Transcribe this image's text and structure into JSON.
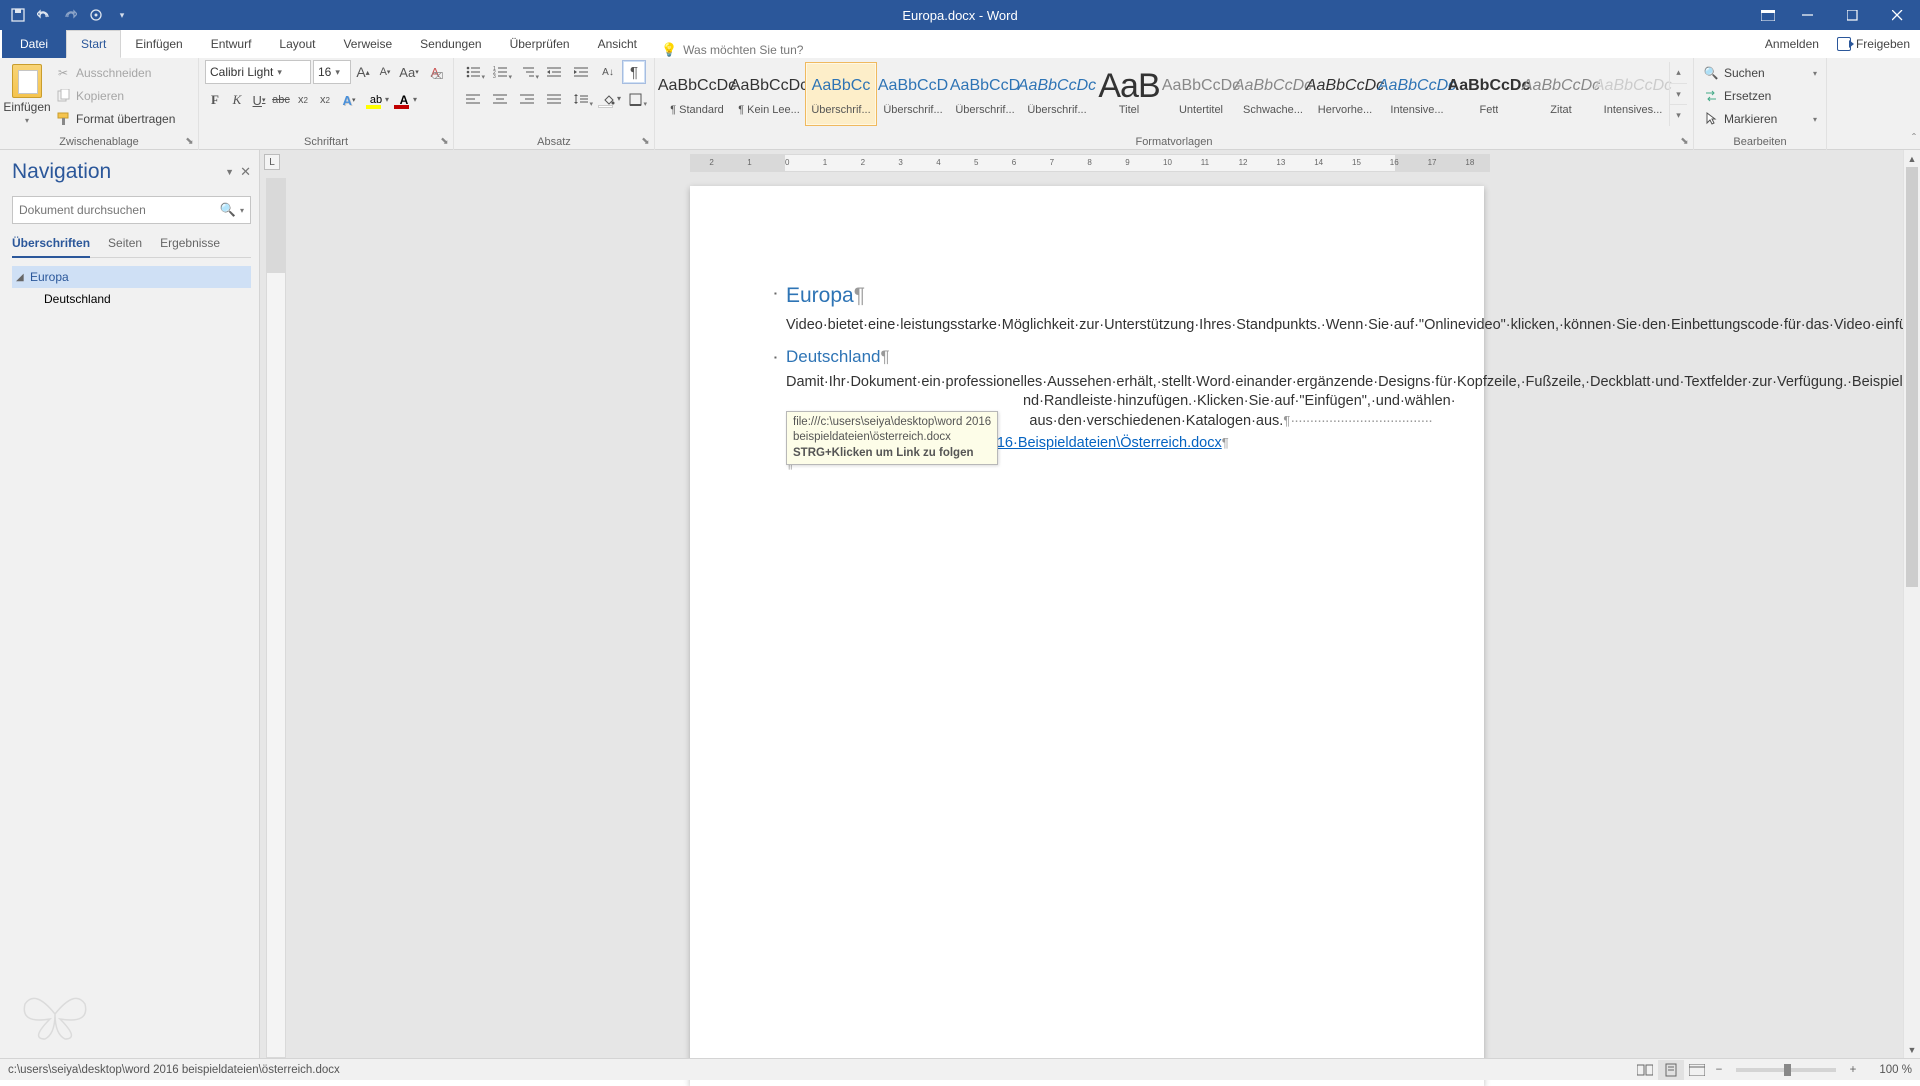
{
  "titlebar": {
    "title": "Europa.docx - Word"
  },
  "tabs": {
    "file": "Datei",
    "items": [
      "Start",
      "Einfügen",
      "Entwurf",
      "Layout",
      "Verweise",
      "Sendungen",
      "Überprüfen",
      "Ansicht"
    ],
    "active": "Start",
    "tellme": "Was möchten Sie tun?",
    "signin": "Anmelden",
    "share": "Freigeben"
  },
  "ribbon": {
    "clipboard": {
      "paste": "Einfügen",
      "cut": "Ausschneiden",
      "copy": "Kopieren",
      "format_painter": "Format übertragen",
      "label": "Zwischenablage"
    },
    "font": {
      "name": "Calibri Light",
      "size": "16",
      "label": "Schriftart"
    },
    "paragraph": {
      "label": "Absatz"
    },
    "styles": {
      "label": "Formatvorlagen",
      "items": [
        {
          "name": "¶ Standard",
          "preview": "AaBbCcDc",
          "cls": ""
        },
        {
          "name": "¶ Kein Lee...",
          "preview": "AaBbCcDc",
          "cls": ""
        },
        {
          "name": "Überschrif...",
          "preview": "AaBbCc",
          "cls": "blue",
          "sel": true
        },
        {
          "name": "Überschrif...",
          "preview": "AaBbCcD",
          "cls": "blue"
        },
        {
          "name": "Überschrif...",
          "preview": "AaBbCcD",
          "cls": "blue"
        },
        {
          "name": "Überschrif...",
          "preview": "AaBbCcDc",
          "cls": "blue ital"
        },
        {
          "name": "Titel",
          "preview": "AaB",
          "cls": "big"
        },
        {
          "name": "Untertitel",
          "preview": "AaBbCcDc",
          "cls": "gray"
        },
        {
          "name": "Schwache...",
          "preview": "AaBbCcDc",
          "cls": "gray ital"
        },
        {
          "name": "Hervorhe...",
          "preview": "AaBbCcDc",
          "cls": "ital"
        },
        {
          "name": "Intensive...",
          "preview": "AaBbCcDc",
          "cls": "blue ital"
        },
        {
          "name": "Fett",
          "preview": "AaBbCcDc",
          "cls": "bold"
        },
        {
          "name": "Zitat",
          "preview": "AaBbCcDc",
          "cls": "gray ital"
        },
        {
          "name": "Intensives...",
          "preview": "AaBbCcDc",
          "cls": "faint ital"
        }
      ]
    },
    "editing": {
      "find": "Suchen",
      "replace": "Ersetzen",
      "select": "Markieren",
      "label": "Bearbeiten"
    }
  },
  "nav": {
    "title": "Navigation",
    "search_placeholder": "Dokument durchsuchen",
    "tabs": [
      "Überschriften",
      "Seiten",
      "Ergebnisse"
    ],
    "active_tab": "Überschriften",
    "tree": {
      "root": "Europa",
      "child": "Deutschland"
    }
  },
  "document": {
    "h1": "Europa",
    "p1": "Video·bietet·eine·leistungsstarke·Möglichkeit·zur·Unterstützung·Ihres·Standpunkts.·Wenn·Sie·auf·\"Onlinevideo\"·klicken,·können·Sie·den·Einbettungscode·für·das·Video·einfügen,·das·hinzugefügt·werden·soll.·Sie·können·auch·ein·Stichwort·eingeben,·um·online·nach·dem·Videoclip·zu·suchen,·der·optimal·zu·Ihrem·Dokument·passt.",
    "h2": "Deutschland",
    "p2a": "Damit·Ihr·Dokument·ein·professionelles·Aussehen·erhält,·stellt·Word·einander·ergänzende·Designs·für·Kopfzeile,·Fußzeile,·Deckblatt·und·Textfelder·zur·Verfügung.·Beispielsweise·können·Sie·ein·",
    "p2b": "nd·Randleiste·hinzufügen.·Klicken·Sie·auf·\"Einfügen\",·und·wählen·",
    "p2c": "aus·den·verschiedenen·Katalogen·aus.",
    "link_text": "C:\\Users\\seiya\\Desktop\\Word·2016·Beispieldateien\\Österreich.docx",
    "tooltip_l1": "file:///c:\\users\\seiya\\desktop\\word 2016",
    "tooltip_l2": "beispieldateien\\österreich.docx",
    "tooltip_l3": "STRG+Klicken um Link zu folgen"
  },
  "statusbar": {
    "path": "c:\\users\\seiya\\desktop\\word 2016 beispieldateien\\österreich.docx",
    "zoom": "100 %"
  }
}
